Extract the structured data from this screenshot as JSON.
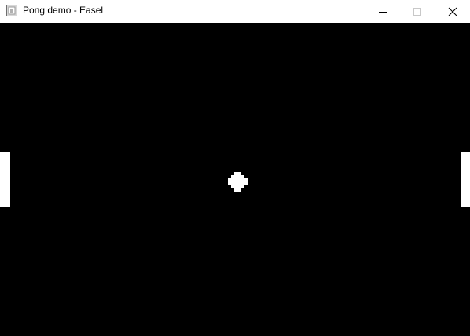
{
  "window": {
    "title": "Pong demo - Easel",
    "controls": {
      "minimize": "minimize",
      "maximize": "maximize",
      "close": "close"
    }
  },
  "game": {
    "background_color": "#000000",
    "foreground_color": "#ffffff",
    "objects": [
      "left-paddle",
      "right-paddle",
      "ball"
    ]
  }
}
